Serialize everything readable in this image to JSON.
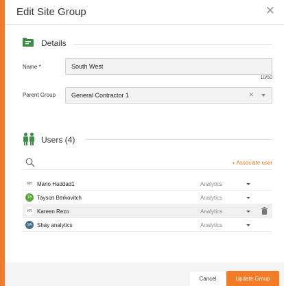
{
  "colors": {
    "accent": "#f47b25",
    "icon_green": "#3d8f47"
  },
  "dialog": {
    "title": "Edit Site Group",
    "close_icon": "close-icon"
  },
  "details": {
    "heading": "Details",
    "name_label": "Name *",
    "name_value": "South West",
    "name_counter": "10/50",
    "parent_label": "Parent Group",
    "parent_value": "General Contractor 1"
  },
  "users": {
    "heading": "Users (4)",
    "associate_label": "+ Associate user",
    "list": [
      {
        "initials": "MH",
        "name": "Mario Haddad1",
        "role": "Analytics",
        "avatar_color": "#ffffff",
        "avatar_style": "plain"
      },
      {
        "initials": "TB",
        "name": "Tayson Berkovitch",
        "role": "Analytics",
        "avatar_color": "#5aa53a",
        "avatar_style": "filled"
      },
      {
        "initials": "KR",
        "name": "Kareen Rezo",
        "role": "Analytics",
        "avatar_color": "#ffffff",
        "avatar_style": "plain"
      },
      {
        "initials": "SA",
        "name": "Shay analytics",
        "role": "Analytics",
        "avatar_color": "#4a6f8a",
        "avatar_style": "filled"
      }
    ]
  },
  "footer": {
    "cancel_label": "Cancel",
    "update_label": "Update Group"
  }
}
